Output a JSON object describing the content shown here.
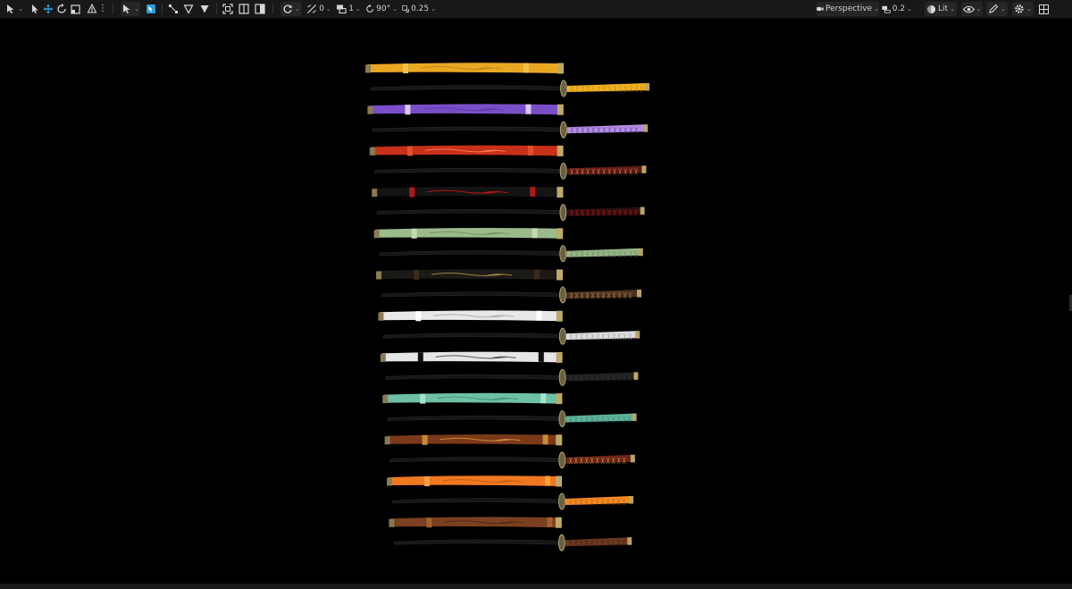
{
  "toolbar": {
    "snap_angle": "0",
    "snap_scale": "1",
    "rotation_snap": "90°",
    "scale_snap": "0.25",
    "view_mode": "Perspective",
    "camera_speed": "0.2",
    "lighting_mode": "Lit"
  },
  "colors": {
    "toolbar_bg": "#181818",
    "viewport_bg": "#000000",
    "accent": "#2a9bd8"
  },
  "icons": [
    "select-mode-icon",
    "arrow-select-icon",
    "move-icon",
    "rotate-icon",
    "scale-icon",
    "snap-icon",
    "more-icon",
    "transform-icon",
    "world-space-icon",
    "surface-snap-icon",
    "vertex-icon",
    "drop-icon",
    "maximize-icon",
    "split-icon",
    "half-icon",
    "rotate-snap-icon",
    "angle-icon",
    "layers-icon",
    "camera-icon",
    "lit-icon",
    "eye-icon",
    "edit-icon",
    "gear-icon",
    "grid-layout-icon"
  ],
  "katanas": [
    {
      "name": "gold",
      "saya": "#e8a822",
      "tsuka": "#f0b020",
      "band": "#f3c04a",
      "pattern": "#b5831a"
    },
    {
      "name": "purple",
      "saya": "#7a4ec8",
      "tsuka": "#b48ee0",
      "band": "#d8c8f0",
      "pattern": "#5a3aa0"
    },
    {
      "name": "red",
      "saya": "#c8301a",
      "tsuka": "#5a1a14",
      "band": "#e0502a",
      "pattern": "#ff8a5a"
    },
    {
      "name": "black-red",
      "saya": "#141414",
      "tsuka": "#2a1010",
      "band": "#b01818",
      "pattern": "#e01414"
    },
    {
      "name": "sage",
      "saya": "#9bbb8a",
      "tsuka": "#94b486",
      "band": "#c5d8b5",
      "pattern": "#6f8c62"
    },
    {
      "name": "black-gold",
      "saya": "#1c1a16",
      "tsuka": "#4a3020",
      "band": "#3a2a1a",
      "pattern": "#c29a50"
    },
    {
      "name": "white",
      "saya": "#e8e8e8",
      "tsuka": "#dcdcdc",
      "band": "#ffffff",
      "pattern": "#a0a0a0"
    },
    {
      "name": "white-ink",
      "saya": "#e6e6e6",
      "tsuka": "#202020",
      "band": "#111111",
      "pattern": "#333333"
    },
    {
      "name": "mint",
      "saya": "#6ec0a6",
      "tsuka": "#5fb29a",
      "band": "#a8e0cc",
      "pattern": "#3f8a74"
    },
    {
      "name": "brown-pattern",
      "saya": "#7a3a1a",
      "tsuka": "#6a2418",
      "band": "#c88a3a",
      "pattern": "#e0a040"
    },
    {
      "name": "orange",
      "saya": "#f07820",
      "tsuka": "#f08a24",
      "band": "#ffa040",
      "pattern": "#c05a10"
    },
    {
      "name": "brown",
      "saya": "#7a4020",
      "tsuka": "#6a3820",
      "band": "#a06030",
      "pattern": "#4a2410"
    }
  ]
}
